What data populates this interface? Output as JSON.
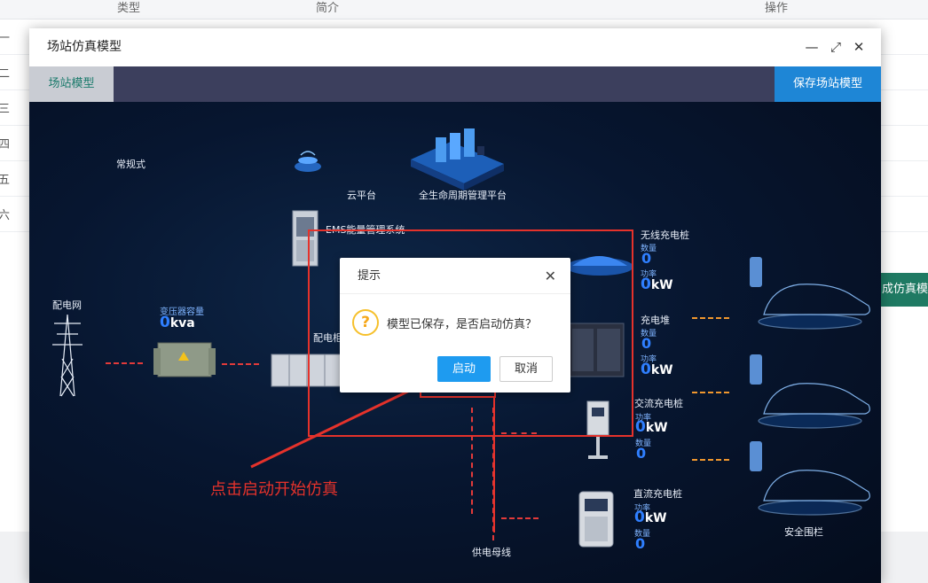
{
  "background": {
    "headers": [
      "类型",
      "简介",
      "操作"
    ],
    "row_marks": [
      "一",
      "二",
      "三",
      "四",
      "五",
      "六"
    ],
    "side_button": "成仿真模"
  },
  "window": {
    "title": "场站仿真模型",
    "controls": {
      "minimize": "—",
      "maximize": "⤢",
      "close": "✕"
    },
    "tab_active": "场站模型",
    "save_button": "保存场站模型"
  },
  "diagram": {
    "mode": "常规式",
    "cloud": "云平台",
    "lifecycle": "全生命周期管理平台",
    "ems": "EMS能量管理系统",
    "grid": "配电网",
    "transformer": {
      "label": "变压器容量",
      "value": "0",
      "unit": "kva"
    },
    "cabinet": "配电柜",
    "wireless": {
      "title": "无线充电桩",
      "qty_label": "数量",
      "qty": "0",
      "pw_label": "功率",
      "pw": "0",
      "pw_unit": "kW"
    },
    "pile_stack": {
      "title": "充电堆",
      "qty_label": "数量",
      "qty": "0",
      "pw_label": "功率",
      "pw": "0",
      "pw_unit": "kW"
    },
    "ac_pile": {
      "title": "交流充电桩",
      "pw_label": "功率",
      "pw": "0",
      "pw_unit": "kW",
      "qty_label": "数量",
      "qty": "0"
    },
    "dc_pile": {
      "title": "直流充电桩",
      "pw_label": "功率",
      "pw": "0",
      "pw_unit": "kW",
      "qty_label": "数量",
      "qty": "0"
    },
    "busbar": "供电母线",
    "fence": "安全围栏"
  },
  "dialog": {
    "title": "提示",
    "close": "✕",
    "icon": "question-icon",
    "message": "模型已保存，是否启动仿真？",
    "confirm": "启动",
    "cancel": "取消"
  },
  "annotation": "点击启动开始仿真",
  "colors": {
    "accent": "#1e86d6",
    "annotation_red": "#e5322b",
    "canvas_dark": "#071630",
    "tab_green": "#1a7a6b"
  }
}
